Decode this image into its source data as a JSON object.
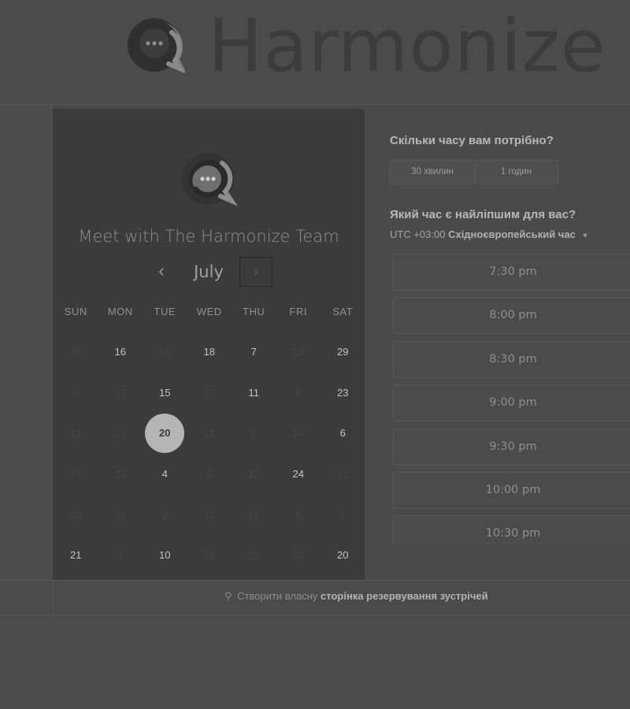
{
  "brand": {
    "name": "Harmonize",
    "icon": "chat-bubble-logo-icon"
  },
  "panel": {
    "title": "Meet with The Harmonize Team",
    "month": "July",
    "prev_glyph": "‹",
    "next_glyph": "›"
  },
  "weekdays": [
    "SUN",
    "MON",
    "TUE",
    "WED",
    "THU",
    "FRI",
    "SAT"
  ],
  "days": [
    {
      "d": "29",
      "s": "off"
    },
    {
      "d": "16",
      "s": "on"
    },
    {
      "d": "15",
      "s": "off"
    },
    {
      "d": "18",
      "s": "on"
    },
    {
      "d": "7",
      "s": "on"
    },
    {
      "d": "23",
      "s": "off"
    },
    {
      "d": "29",
      "s": "on"
    },
    {
      "d": "8",
      "s": "off"
    },
    {
      "d": "22",
      "s": "off"
    },
    {
      "d": "15",
      "s": "on"
    },
    {
      "d": "31",
      "s": "off"
    },
    {
      "d": "11",
      "s": "on"
    },
    {
      "d": "8",
      "s": "off"
    },
    {
      "d": "23",
      "s": "on"
    },
    {
      "d": "13",
      "s": "off"
    },
    {
      "d": "21",
      "s": "off"
    },
    {
      "d": "20",
      "s": "sel"
    },
    {
      "d": "11",
      "s": "off"
    },
    {
      "d": "8",
      "s": "off"
    },
    {
      "d": "14",
      "s": "off"
    },
    {
      "d": "6",
      "s": "on"
    },
    {
      "d": "25",
      "s": "off"
    },
    {
      "d": "25",
      "s": "off"
    },
    {
      "d": "4",
      "s": "on"
    },
    {
      "d": "3",
      "s": "off"
    },
    {
      "d": "12",
      "s": "off"
    },
    {
      "d": "24",
      "s": "on"
    },
    {
      "d": "31",
      "s": "off"
    },
    {
      "d": "20",
      "s": "off"
    },
    {
      "d": "11",
      "s": "off"
    },
    {
      "d": "2",
      "s": "off"
    },
    {
      "d": "13",
      "s": "off"
    },
    {
      "d": "16",
      "s": "off"
    },
    {
      "d": "6",
      "s": "off"
    },
    {
      "d": "7",
      "s": "off"
    },
    {
      "d": "21",
      "s": "on"
    },
    {
      "d": "7",
      "s": "off"
    },
    {
      "d": "10",
      "s": "on"
    },
    {
      "d": "24",
      "s": "off"
    },
    {
      "d": "25",
      "s": "off"
    },
    {
      "d": "24",
      "s": "off"
    },
    {
      "d": "20",
      "s": "on"
    }
  ],
  "duration": {
    "question": "Скільки часу вам потрібно?",
    "options": [
      "30 хвилин",
      "1 годин"
    ]
  },
  "time": {
    "question": "Який час є найліпшим для вас?",
    "tz_offset": "UTC +03:00",
    "tz_name": "Східноєвропейський час",
    "slots": [
      "7:30 pm",
      "8:00 pm",
      "8:30 pm",
      "9:00 pm",
      "9:30 pm",
      "10:00 pm",
      "10:30 pm"
    ]
  },
  "footer": {
    "prefix": "Створити власну",
    "link": "сторінка резервування зустрічей"
  },
  "colors": {
    "page_bg": "#4b4b4b",
    "panel_bg": "#3b3b3b",
    "selected_day": "#b4b4b4"
  }
}
